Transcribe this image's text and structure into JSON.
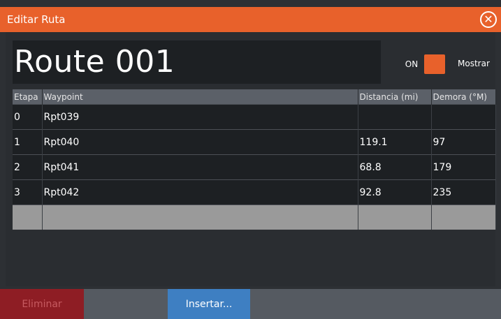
{
  "window": {
    "title": "Editar Ruta"
  },
  "route": {
    "name": "Route 001",
    "toggle_state": "ON",
    "show_label": "Mostrar"
  },
  "table": {
    "headers": [
      "Etapa",
      "Waypoint",
      "Distancia (mi)",
      "Demora (°M)"
    ],
    "rows": [
      [
        "0",
        "Rpt039",
        "",
        ""
      ],
      [
        "1",
        "Rpt040",
        "119.1",
        "97"
      ],
      [
        "2",
        "Rpt041",
        "68.8",
        "179"
      ],
      [
        "3",
        "Rpt042",
        "92.8",
        "235"
      ]
    ]
  },
  "actions": {
    "delete_label": "Eliminar",
    "insert_label": "Insertar..."
  },
  "colors": {
    "accent": "#e8612b",
    "insert": "#3e7fc2",
    "delete": "#8e1d24"
  }
}
